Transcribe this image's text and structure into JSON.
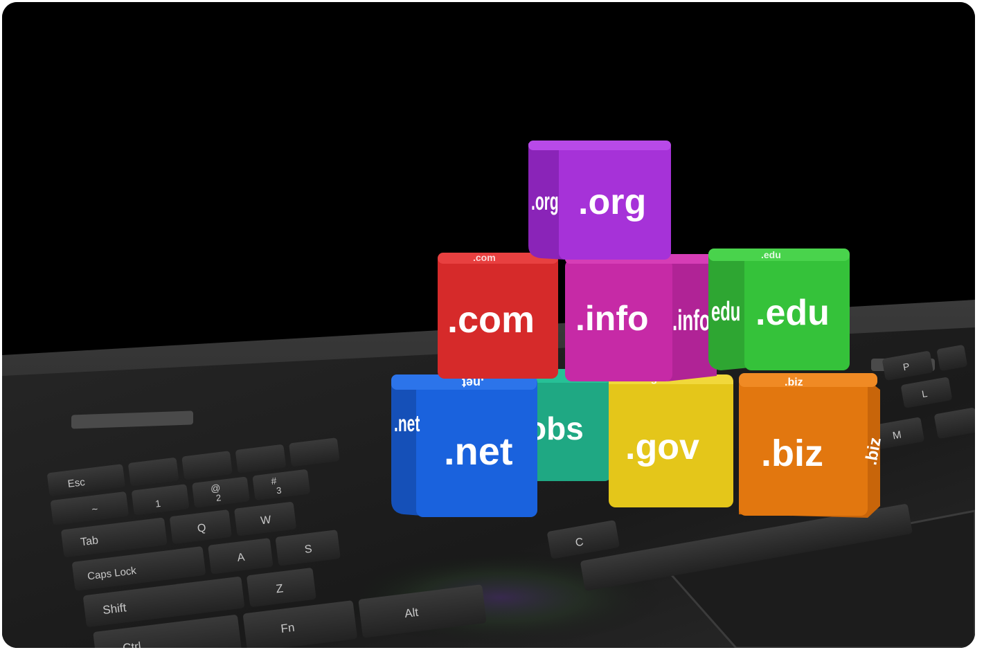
{
  "scene": {
    "description_colors": {
      "background": "#000000",
      "laptop": "#2b2b2b",
      "org": "#a632d8",
      "com": "#d62a2a",
      "info": "#c62aa6",
      "edu": "#35c23a",
      "net": "#1a62dd",
      "jobs": "#1fa883",
      "gov": "#e4c61a",
      "biz": "#e2770f"
    }
  },
  "cubes": {
    "org": {
      "front": ".org",
      "side": ".org"
    },
    "com": {
      "front": ".com",
      "top": ".com"
    },
    "info": {
      "front": ".info",
      "side": ".info"
    },
    "edu": {
      "front": ".edu",
      "side": "edu",
      "top": ".edu"
    },
    "net": {
      "front": ".net",
      "side": ".net",
      "top": ".net"
    },
    "jobs": {
      "front": "obs"
    },
    "gov": {
      "front": ".gov",
      "top": ".gov"
    },
    "biz": {
      "front": ".biz",
      "side": ".biz",
      "top": ".biz"
    }
  },
  "keyboard": {
    "esc": "Esc",
    "tilde": "~",
    "one": "1",
    "two": "2",
    "at": "@",
    "three": "3",
    "hash": "#",
    "tab": "Tab",
    "q": "Q",
    "w": "W",
    "caps": "Caps Lock",
    "a": "A",
    "s": "S",
    "shift": "Shift",
    "z": "Z",
    "ctrl": "Ctrl",
    "fn": "Fn",
    "alt": "Alt",
    "c": "C",
    "m": "M",
    "l": "L",
    "p": "P"
  }
}
